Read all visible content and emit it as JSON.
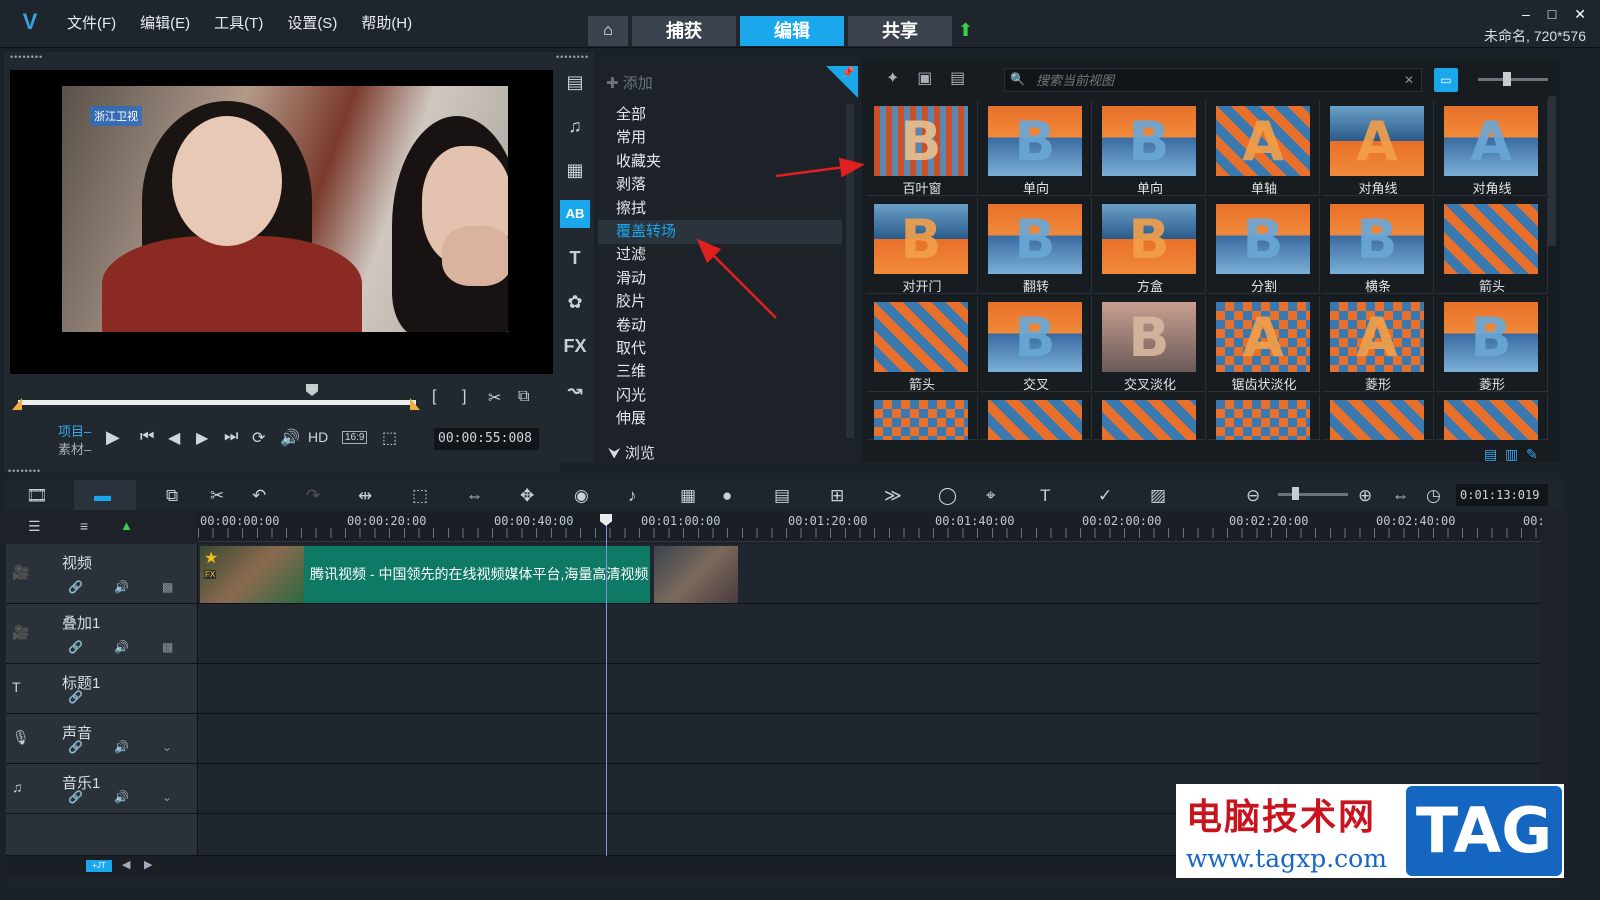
{
  "menu": {
    "items": [
      "文件(F)",
      "编辑(E)",
      "工具(T)",
      "设置(S)",
      "帮助(H)"
    ]
  },
  "tabs": {
    "home": "⌂",
    "capture": "捕获",
    "edit": "编辑",
    "share": "共享"
  },
  "project": {
    "info": "未命名, 720*576"
  },
  "player": {
    "channel_logo": "浙江卫视",
    "mode_project": "项目–",
    "mode_clip": "素材–",
    "timecode": "00:00:55:008",
    "hd": "HD",
    "aspect": "16:9"
  },
  "library": {
    "add_label": "添加",
    "categories": [
      "全部",
      "常用",
      "收藏夹",
      "剥落",
      "擦拭",
      "覆盖转场",
      "过滤",
      "滑动",
      "胶片",
      "卷动",
      "取代",
      "三维",
      "闪光",
      "伸展"
    ],
    "selected_category": "覆盖转场",
    "browse": "浏览",
    "search_placeholder": "搜索当前视图",
    "thumbnails": [
      "百叶窗",
      "单向",
      "单向",
      "单轴",
      "对角线",
      "对角线",
      "对开门",
      "翻转",
      "方盒",
      "分割",
      "横条",
      "箭头",
      "箭头",
      "交叉",
      "交叉淡化",
      "锯齿状淡化",
      "菱形",
      "菱形"
    ]
  },
  "timeline": {
    "timecode": "0:01:13:019",
    "ruler": [
      "00:00:00:00",
      "00:00:20:00",
      "00:00:40:00",
      "00:01:00:00",
      "00:01:20:00",
      "00:01:40:00",
      "00:02:00:00",
      "00:02:20:00",
      "00:02:40:00",
      "00:"
    ],
    "tracks": [
      "视频",
      "叠加1",
      "标题1",
      "声音",
      "音乐1"
    ],
    "clip_title": "腾讯视频 - 中国领先的在线视频媒体平台,海量高清视频"
  },
  "watermark": {
    "cn": "电脑技术网",
    "url": "www.tagxp.com",
    "tag": "TAG"
  },
  "colors": {
    "accent": "#1aa7ec",
    "clip": "#0e7a66",
    "bg": "#1b2128"
  }
}
